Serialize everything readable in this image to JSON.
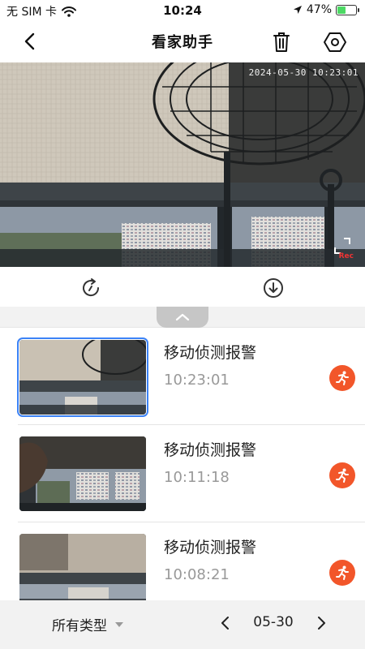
{
  "status_bar": {
    "carrier": "无 SIM 卡",
    "time": "10:24",
    "battery": "47%",
    "battery_level": 0.47,
    "icons": [
      "wifi-icon",
      "location-arrow-icon",
      "battery-charging-icon"
    ]
  },
  "nav": {
    "title": "看家助手",
    "icons": [
      "chevron-left-icon",
      "trash-icon",
      "hexagon-settings-icon"
    ]
  },
  "video": {
    "timestamp": "2024-05-30 10:23:01",
    "rec_label": "Rec",
    "icons": [
      "fullscreen-icon"
    ]
  },
  "toolbar": {
    "icons": [
      "replay-icon",
      "download-icon"
    ]
  },
  "events": [
    {
      "title": "移动侦测报警",
      "time": "10:23:01",
      "selected": true,
      "icon": "motion-run-icon"
    },
    {
      "title": "移动侦测报警",
      "time": "10:11:18",
      "selected": false,
      "icon": "motion-run-icon"
    },
    {
      "title": "移动侦测报警",
      "time": "10:08:21",
      "selected": false,
      "icon": "motion-run-icon"
    }
  ],
  "bottom_bar": {
    "filter_label": "所有类型",
    "date": "05-30"
  },
  "colors": {
    "accent": "#f2562a",
    "selected_border": "#3b82f6",
    "battery_green": "#4cd964"
  }
}
